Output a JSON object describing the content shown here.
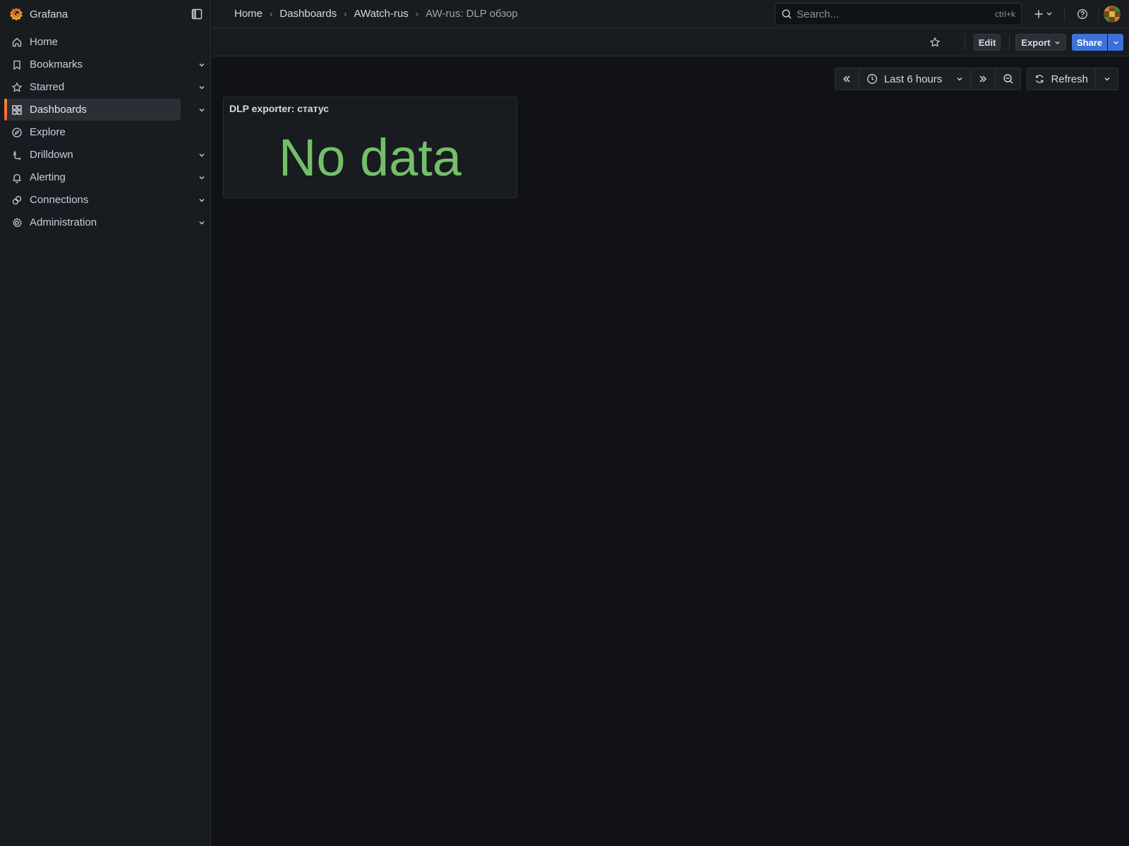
{
  "brand": {
    "name": "Grafana"
  },
  "sidebar": {
    "items": [
      {
        "label": "Home",
        "icon": "home-icon",
        "expandable": false,
        "active": false
      },
      {
        "label": "Bookmarks",
        "icon": "bookmark-icon",
        "expandable": true,
        "active": false
      },
      {
        "label": "Starred",
        "icon": "star-icon",
        "expandable": true,
        "active": false
      },
      {
        "label": "Dashboards",
        "icon": "apps-grid-icon",
        "expandable": true,
        "active": true
      },
      {
        "label": "Explore",
        "icon": "compass-icon",
        "expandable": false,
        "active": false
      },
      {
        "label": "Drilldown",
        "icon": "drilldown-icon",
        "expandable": true,
        "active": false
      },
      {
        "label": "Alerting",
        "icon": "bell-icon",
        "expandable": true,
        "active": false
      },
      {
        "label": "Connections",
        "icon": "link-icon",
        "expandable": true,
        "active": false
      },
      {
        "label": "Administration",
        "icon": "cog-icon",
        "expandable": true,
        "active": false
      }
    ]
  },
  "breadcrumb": {
    "items": [
      "Home",
      "Dashboards",
      "AWatch-rus",
      "AW-rus: DLP обзор"
    ],
    "separator": "›"
  },
  "search": {
    "placeholder": "Search...",
    "shortcut": "ctrl+k"
  },
  "toolbar": {
    "edit_label": "Edit",
    "export_label": "Export",
    "share_label": "Share"
  },
  "timepicker": {
    "range_label": "Last 6 hours",
    "refresh_label": "Refresh"
  },
  "panel": {
    "title": "DLP exporter: статус",
    "value": "No data",
    "value_color": "#73bf69"
  },
  "colors": {
    "accent": "#3d71d9",
    "active_indicator": "#ff8833",
    "background": "#111217",
    "surface": "#181b1f"
  }
}
